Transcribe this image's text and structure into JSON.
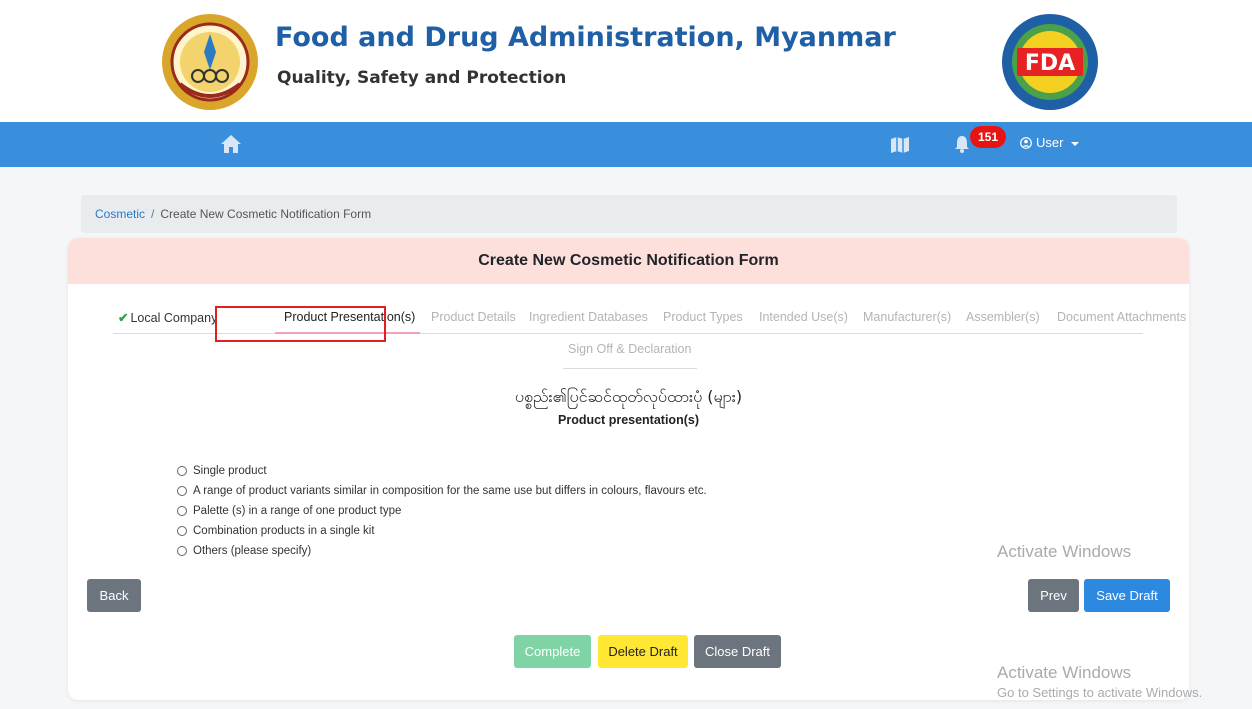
{
  "header": {
    "title": "Food and Drug Administration, Myanmar",
    "tagline": "Quality, Safety and Protection",
    "left_logo_icon": "ministry-seal-icon",
    "right_logo_icon": "fda-seal-icon",
    "right_logo_text": "FDA"
  },
  "navbar": {
    "home_icon": "home-icon",
    "book_icon": "book-map-icon",
    "bell_icon": "bell-icon",
    "notification_count": "151",
    "user_label": "User",
    "color": "#3a8fdc"
  },
  "breadcrumb": {
    "parent": "Cosmetic",
    "separator": "/",
    "current": "Create New Cosmetic Notification Form"
  },
  "form": {
    "title": "Create New Cosmetic Notification Form",
    "tabs": [
      {
        "label": "Local Company",
        "state": "done"
      },
      {
        "label": "Product Presentation(s)",
        "state": "active"
      },
      {
        "label": "Product Details",
        "state": "disabled"
      },
      {
        "label": "Ingredient Databases",
        "state": "disabled"
      },
      {
        "label": "Product Types",
        "state": "disabled"
      },
      {
        "label": "Intended Use(s)",
        "state": "disabled"
      },
      {
        "label": "Manufacturer(s)",
        "state": "disabled"
      },
      {
        "label": "Assembler(s)",
        "state": "disabled"
      },
      {
        "label": "Document Attachments",
        "state": "disabled"
      },
      {
        "label": "Sign Off & Declaration",
        "state": "disabled"
      }
    ],
    "section_title_mm": "ပစ္စည်း၏ပြင်ဆင်ထုတ်လုပ်ထားပုံ (များ)",
    "section_title_en": "Product presentation(s)",
    "options": [
      "Single product",
      "A range of product variants similar in composition for the same use but differs in colours, flavours etc.",
      "Palette (s) in a range of one product type",
      "Combination products in a single kit",
      "Others (please specify)"
    ],
    "buttons": {
      "back": "Back",
      "prev": "Prev",
      "save_draft": "Save Draft",
      "complete": "Complete",
      "delete_draft": "Delete Draft",
      "close_draft": "Close Draft"
    }
  },
  "watermark": {
    "line1": "Activate Windows",
    "line2": "Activate Windows",
    "line3": "Go to Settings to activate Windows."
  }
}
